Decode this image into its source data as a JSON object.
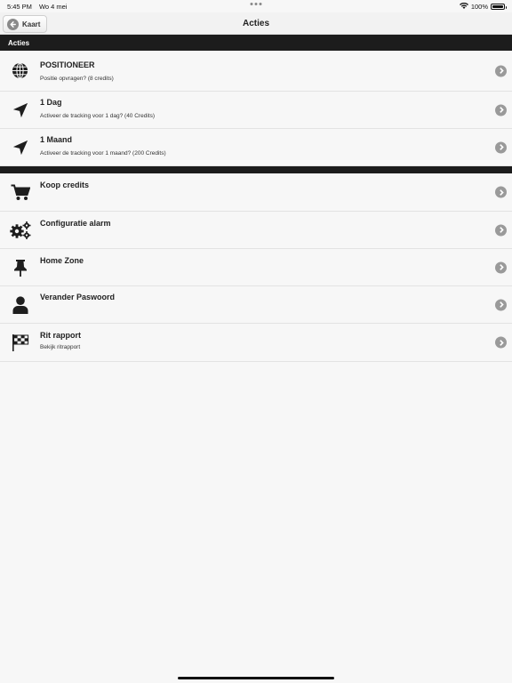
{
  "status_bar": {
    "time": "5:45 PM",
    "date": "Wo 4 mei",
    "battery": "100%",
    "battery_level": 1.0
  },
  "nav": {
    "back_label": "Kaart",
    "title": "Acties"
  },
  "section1": {
    "header": "Acties",
    "items": [
      {
        "title": "POSITIONEER",
        "subtitle": "Positie opvragen? (8 credits)",
        "icon": "globe-icon"
      },
      {
        "title": "1 Dag",
        "subtitle": "Activeer de tracking voor 1 dag? (40 Credits)",
        "icon": "location-arrow-icon"
      },
      {
        "title": "1 Maand",
        "subtitle": "Activeer de tracking voor 1 maand? (200 Credits)",
        "icon": "location-arrow-icon"
      }
    ]
  },
  "section2": {
    "items": [
      {
        "title": "Koop credits",
        "subtitle": "",
        "icon": "shopping-cart-icon"
      },
      {
        "title": "Configuratie alarm",
        "subtitle": "",
        "icon": "gears-icon"
      },
      {
        "title": "Home Zone",
        "subtitle": "",
        "icon": "pushpin-icon"
      },
      {
        "title": "Verander Paswoord",
        "subtitle": "",
        "icon": "user-icon"
      },
      {
        "title": "Rit rapport",
        "subtitle": "Bekijk ritrapport",
        "icon": "checkered-flag-icon"
      }
    ]
  }
}
